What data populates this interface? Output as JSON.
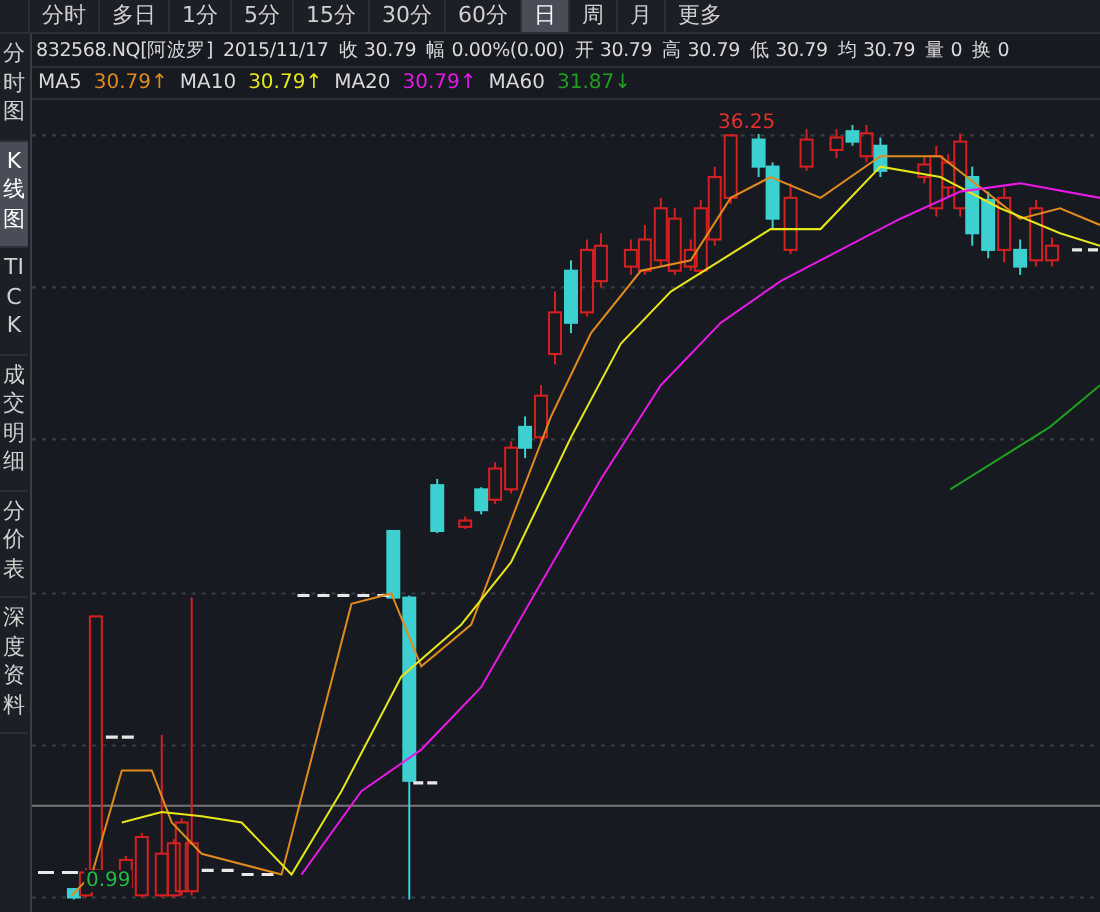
{
  "period_tabs": [
    {
      "label": "分时",
      "selected": false
    },
    {
      "label": "多日",
      "selected": false
    },
    {
      "label": "1分",
      "selected": false
    },
    {
      "label": "5分",
      "selected": false
    },
    {
      "label": "15分",
      "selected": false
    },
    {
      "label": "30分",
      "selected": false
    },
    {
      "label": "60分",
      "selected": false
    },
    {
      "label": "日",
      "selected": true
    },
    {
      "label": "周",
      "selected": false
    },
    {
      "label": "月",
      "selected": false
    },
    {
      "label": "更多",
      "selected": false
    }
  ],
  "side_tabs": [
    {
      "label": "分时图",
      "selected": false
    },
    {
      "label": "K线图",
      "selected": true
    },
    {
      "label": "TICK",
      "selected": false
    },
    {
      "label": "成交明细",
      "selected": false
    },
    {
      "label": "分价表",
      "selected": false
    },
    {
      "label": "深度资料",
      "selected": false
    }
  ],
  "quote": {
    "symbol": "832568.NQ[阿波罗]",
    "date": "2015/11/17",
    "fields": [
      {
        "label": "收",
        "value": "30.79"
      },
      {
        "label": "幅",
        "value": "0.00%(0.00)"
      },
      {
        "label": "开",
        "value": "30.79"
      },
      {
        "label": "高",
        "value": "30.79"
      },
      {
        "label": "低",
        "value": "30.79"
      },
      {
        "label": "均",
        "value": "30.79"
      },
      {
        "label": "量",
        "value": "0"
      },
      {
        "label": "换",
        "value": "0"
      }
    ]
  },
  "moving_averages": [
    {
      "name": "MA5",
      "value": "30.79↑",
      "color": "#e08a1e"
    },
    {
      "name": "MA10",
      "value": "30.79↑",
      "color": "#e6e619"
    },
    {
      "name": "MA20",
      "value": "30.79↑",
      "color": "#e619e6"
    },
    {
      "name": "MA60",
      "value": "31.87↓",
      "color": "#1ea01e"
    }
  ],
  "chart": {
    "high_label": "36.25",
    "low_label": "0.99"
  }
}
